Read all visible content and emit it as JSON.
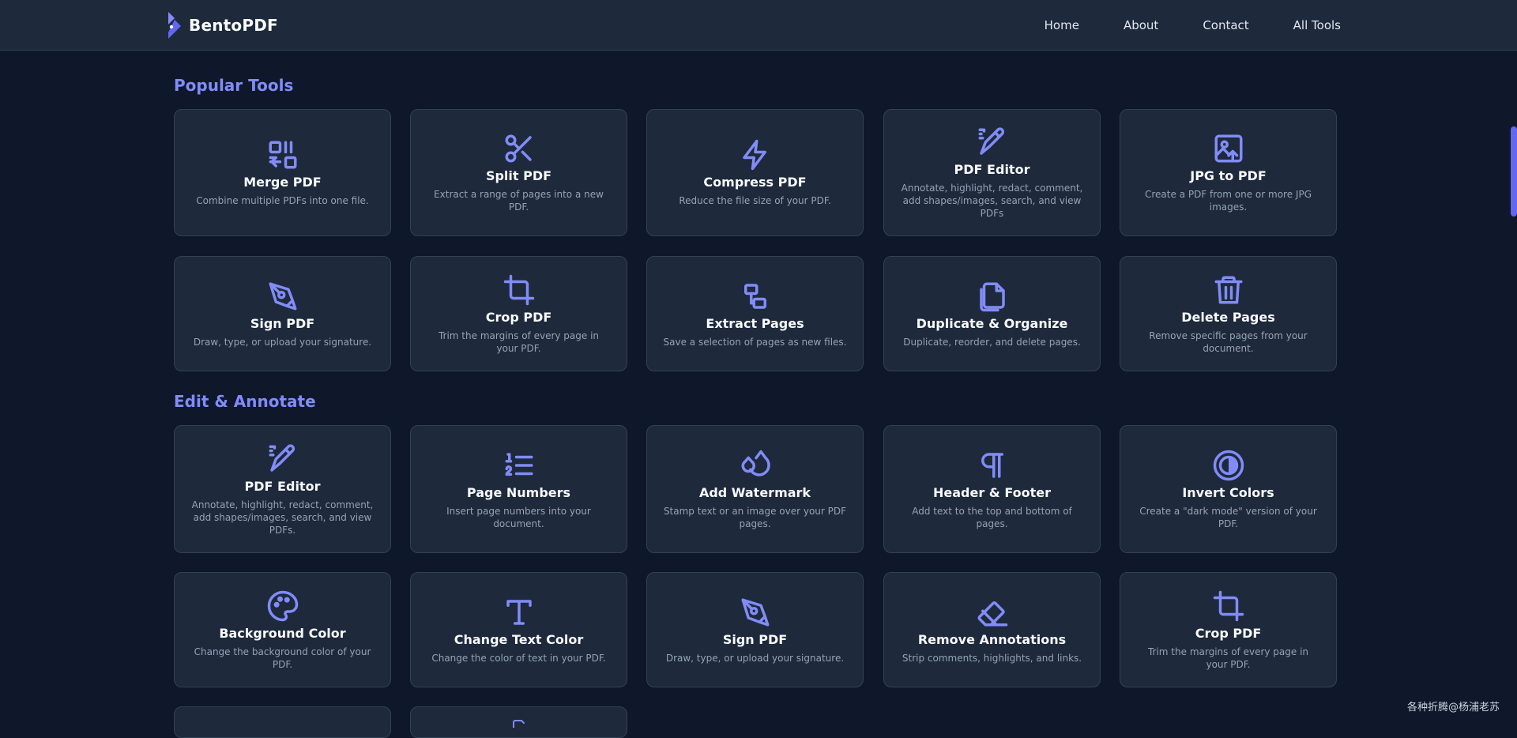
{
  "brand": {
    "name": "BentoPDF",
    "logo_icon": "bentopdf-logo-icon"
  },
  "nav": {
    "items": [
      "Home",
      "About",
      "Contact",
      "All Tools"
    ]
  },
  "sections": {
    "popular": {
      "title": "Popular Tools",
      "cards": [
        {
          "icon": "merge-icon",
          "title": "Merge PDF",
          "desc": "Combine multiple PDFs into one file."
        },
        {
          "icon": "scissors-icon",
          "title": "Split PDF",
          "desc": "Extract a range of pages into a new PDF."
        },
        {
          "icon": "lightning-icon",
          "title": "Compress PDF",
          "desc": "Reduce the file size of your PDF."
        },
        {
          "icon": "pen-tool-icon",
          "title": "PDF Editor",
          "desc": "Annotate, highlight, redact, comment, add shapes/images, search, and view PDFs"
        },
        {
          "icon": "image-upload-icon",
          "title": "JPG to PDF",
          "desc": "Create a PDF from one or more JPG images."
        },
        {
          "icon": "signature-pen-icon",
          "title": "Sign PDF",
          "desc": "Draw, type, or upload your signature."
        },
        {
          "icon": "crop-icon",
          "title": "Crop PDF",
          "desc": "Trim the margins of every page in your PDF."
        },
        {
          "icon": "extract-squares-icon",
          "title": "Extract Pages",
          "desc": "Save a selection of pages as new files."
        },
        {
          "icon": "copy-files-icon",
          "title": "Duplicate & Organize",
          "desc": "Duplicate, reorder, and delete pages."
        },
        {
          "icon": "trash-icon",
          "title": "Delete Pages",
          "desc": "Remove specific pages from your document."
        }
      ]
    },
    "edit": {
      "title": "Edit & Annotate",
      "cards": [
        {
          "icon": "pen-tool-icon",
          "title": "PDF Editor",
          "desc": "Annotate, highlight, redact, comment, add shapes/images, search, and view PDFs."
        },
        {
          "icon": "numbered-list-icon",
          "title": "Page Numbers",
          "desc": "Insert page numbers into your document."
        },
        {
          "icon": "droplets-icon",
          "title": "Add Watermark",
          "desc": "Stamp text or an image over your PDF pages."
        },
        {
          "icon": "pilcrow-icon",
          "title": "Header & Footer",
          "desc": "Add text to the top and bottom of pages."
        },
        {
          "icon": "contrast-icon",
          "title": "Invert Colors",
          "desc": "Create a \"dark mode\" version of your PDF."
        },
        {
          "icon": "palette-icon",
          "title": "Background Color",
          "desc": "Change the background color of your PDF."
        },
        {
          "icon": "type-icon",
          "title": "Change Text Color",
          "desc": "Change the color of text in your PDF."
        },
        {
          "icon": "signature-pen-icon",
          "title": "Sign PDF",
          "desc": "Draw, type, or upload your signature."
        },
        {
          "icon": "eraser-icon",
          "title": "Remove Annotations",
          "desc": "Strip comments, highlights, and links."
        },
        {
          "icon": "crop-icon",
          "title": "Crop PDF",
          "desc": "Trim the margins of every page in your PDF."
        }
      ]
    }
  },
  "watermark": "各种折腾@杨浦老苏",
  "colors": {
    "accent": "#818cf8",
    "background": "#0f172a",
    "card": "#1e293b",
    "border": "#334155"
  }
}
